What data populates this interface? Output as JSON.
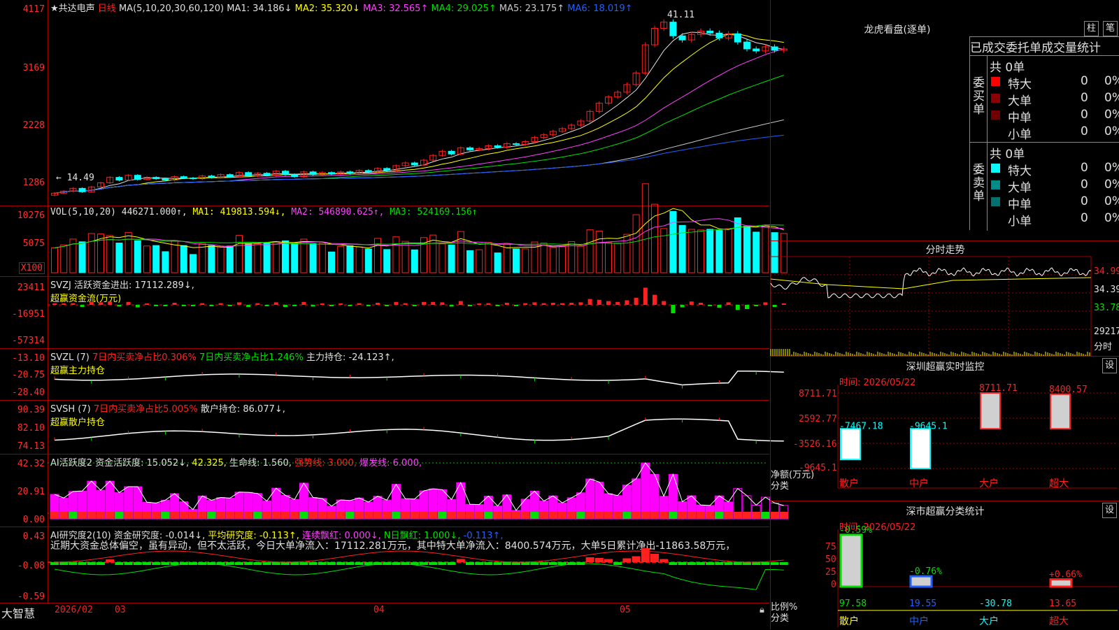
{
  "main": {
    "title": "★共达电声",
    "period": "日线",
    "ma_label": "MA(5,10,20,30,60,120)",
    "ma": [
      {
        "label": "MA1: 34.186↓",
        "color": "#e0e0e0"
      },
      {
        "label": "MA2: 35.320↓",
        "color": "#ffff00"
      },
      {
        "label": "MA3: 32.565↑",
        "color": "#ff40ff"
      },
      {
        "label": "MA4: 29.025↑",
        "color": "#00e000"
      },
      {
        "label": "MA5: 23.175↑",
        "color": "#c8c8c8"
      },
      {
        "label": "MA6: 18.019↑",
        "color": "#2060ff"
      }
    ],
    "high_mark": "41.11",
    "low_mark": "← 14.49",
    "y_labels": [
      "4117",
      "3169",
      "2228",
      "1286"
    ],
    "candles": [
      14.9,
      15.2,
      15.6,
      15.1,
      15.8,
      16.4,
      17.2,
      16.8,
      17.5,
      16.9,
      17.2,
      17.0,
      16.8,
      17.3,
      17.1,
      17.0,
      17.4,
      17.2,
      17.6,
      17.3,
      17.9,
      17.4,
      17.8,
      17.5,
      18.1,
      17.6,
      17.3,
      18.0,
      17.6,
      17.9,
      17.7,
      18.0,
      17.8,
      18.2,
      18.0,
      18.5,
      18.2,
      18.9,
      19.3,
      19.0,
      19.7,
      20.4,
      21.0,
      20.6,
      21.5,
      21.2,
      21.4,
      21.8,
      21.6,
      22.1,
      22.0,
      22.4,
      23.0,
      23.4,
      23.9,
      24.3,
      24.8,
      25.4,
      26.8,
      28.0,
      28.9,
      29.6,
      30.7,
      32.4,
      36.5,
      38.9,
      39.8,
      37.8,
      37.2,
      38.0,
      38.5,
      38.2,
      37.5,
      38.1,
      36.9,
      35.9,
      35.6,
      36.2,
      35.7,
      35.9
    ]
  },
  "vol": {
    "label": "VOL(5,10,20)",
    "v1": "446271.000↑,",
    "ma": [
      {
        "label": "MA1: 419813.594↓,",
        "color": "#ffff00"
      },
      {
        "label": "MA2: 546890.625↑,",
        "color": "#ff40ff"
      },
      {
        "label": "MA3: 524169.156↑",
        "color": "#00e000"
      }
    ],
    "y_labels": [
      "10276",
      "5075"
    ],
    "unit": "X100"
  },
  "svzj": {
    "name": "SVZJ",
    "text": "活跃资金进出: 17112.289↓,",
    "sub": "超赢资金流(万元)",
    "y_labels": [
      "23411",
      "-16951",
      "-57314"
    ]
  },
  "svzl": {
    "name": "SVZL (7)",
    "t1": "7日内买卖净占比0.306%",
    "t2": "7日内买卖净占比1.246%",
    "t3": "主力持仓: -24.123↑,",
    "sub": "超赢主力持仓",
    "y_labels": [
      "-13.10",
      "-20.75",
      "-28.40"
    ]
  },
  "svsh": {
    "name": "SVSH (7)",
    "t1": "7日内买卖净占比5.005%",
    "t2": "散户持仓: 86.077↓,",
    "sub": "超赢散户持仓",
    "y_labels": [
      "90.39",
      "82.10",
      "74.13"
    ]
  },
  "ai1": {
    "name": "AI活跃度2",
    "t1": "资金活跃度: 15.052↓,",
    "t2": "42.325,",
    "t3": "生命线: 1.560,",
    "t4": "强势线: 3.000,",
    "t5": "爆发线: 6.000,",
    "y_labels": [
      "42.32",
      "20.91",
      "0.00"
    ]
  },
  "ai2": {
    "name": "AI研究度2(10)",
    "t1": "资金研究度: -0.014↓,",
    "t2": "平均研究度: -0.113↑,",
    "t3": "连续飘红: 0.000↓,",
    "t4": "N日飘红: 1.000↓,",
    "t5": "-0.113↑,",
    "summary": "近期大资金总体偏空，虽有异动，但不太活跃，今日大单净流入：17112.281万元，其中特大单净流入：8400.574万元，大单5日累计净出-11863.58万元，",
    "y_labels": [
      "0.43",
      "-0.08",
      "-0.59"
    ]
  },
  "xaxis": {
    "labels": [
      "2026/02",
      "03",
      "04",
      "05"
    ],
    "brand": "大智慧"
  },
  "longhu": {
    "title": "龙虎看盘(逐单)",
    "btn1": "柱",
    "btn2": "笔",
    "subtitle": "已成交委托单成交量统计",
    "buy_label": "委买单",
    "sell_label": "委卖单",
    "buy_total": "共 0单",
    "sell_total": "共 0单",
    "buy_rows": [
      {
        "name": "特大",
        "v": "0",
        "p": "0%",
        "color": "#ff0000"
      },
      {
        "name": "大单",
        "v": "0",
        "p": "0%",
        "color": "#8b0000"
      },
      {
        "name": "中单",
        "v": "0",
        "p": "0%",
        "color": "#700000"
      },
      {
        "name": "小单",
        "v": "0",
        "p": "0%",
        "color": ""
      }
    ],
    "sell_rows": [
      {
        "name": "特大",
        "v": "0",
        "p": "0%",
        "color": "#00ffff"
      },
      {
        "name": "大单",
        "v": "0",
        "p": "0%",
        "color": "#008b8b"
      },
      {
        "name": "中单",
        "v": "0",
        "p": "0%",
        "color": "#007070"
      },
      {
        "name": "小单",
        "v": "0",
        "p": "0%",
        "color": ""
      }
    ]
  },
  "intraday": {
    "title": "分时走势",
    "right_labels": [
      "34.99",
      "34.39",
      "33.78",
      "29217",
      "分时"
    ]
  },
  "sz_monitor": {
    "title": "深圳超赢实时监控",
    "btn": "设",
    "time": "时间: 2026/05/22",
    "y_labels": [
      "8711.71",
      "2592.77",
      "-3526.16",
      "-9645.1"
    ],
    "unit": "净额(万元)",
    "cat_label": "分类",
    "bars": [
      {
        "name": "散户",
        "value": -7467.18,
        "label": "-7467.18"
      },
      {
        "name": "中户",
        "value": -9645.1,
        "label": "-9645.1"
      },
      {
        "name": "大户",
        "value": 8711.71,
        "label": "8711.71"
      },
      {
        "name": "超大",
        "value": 8400.57,
        "label": "8400.57"
      }
    ]
  },
  "sz_class": {
    "title": "深市超赢分类统计",
    "btn": "设",
    "time": "时间: 2026/05/22",
    "y_labels": [
      "75",
      "50",
      "25",
      "0"
    ],
    "unit": "比例%",
    "cat_label": "分类",
    "bars": [
      {
        "name": "散户",
        "value": 97.58,
        "label": "97.58",
        "pct": "-0.59%"
      },
      {
        "name": "中户",
        "value": 19.55,
        "label": "19.55",
        "pct": "-0.76%"
      },
      {
        "name": "大户",
        "value": -30.78,
        "label": "-30.78",
        "pct": ""
      },
      {
        "name": "超大",
        "value": 13.65,
        "label": "13.65",
        "pct": "+0.66%"
      }
    ]
  }
}
